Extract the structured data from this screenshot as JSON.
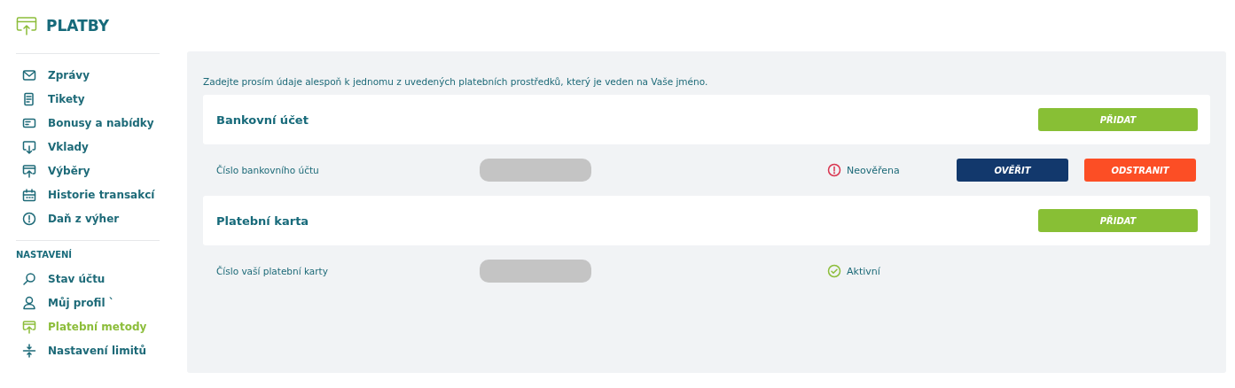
{
  "header": {
    "title": "PLATBY"
  },
  "sidebar": {
    "groups": [
      {
        "items": [
          {
            "label": "Zprávy",
            "selected": false
          },
          {
            "label": "Tikety",
            "selected": false
          },
          {
            "label": "Bonusy a nabídky",
            "selected": false
          },
          {
            "label": "Vklady",
            "selected": false
          },
          {
            "label": "Výběry",
            "selected": false
          },
          {
            "label": "Historie transakcí",
            "selected": false
          },
          {
            "label": "Daň z výher",
            "selected": false
          }
        ]
      },
      {
        "heading": "NASTAVENÍ",
        "items": [
          {
            "label": "Stav účtu",
            "selected": false
          },
          {
            "label": "Můj profil `",
            "selected": false
          },
          {
            "label": "Platební metody",
            "selected": true
          },
          {
            "label": "Nastavení limitů",
            "selected": false
          }
        ]
      }
    ]
  },
  "main": {
    "intro": "Zadejte prosím údaje alespoň k jednomu z uvedených platebních prostředků, který je veden na Vaše jméno.",
    "sections": [
      {
        "title": "Bankovní účet",
        "add_button": "PŘIDAT",
        "row": {
          "label": "Číslo bankovního účtu",
          "masked": true,
          "status": {
            "kind": "unverified",
            "text": "Neověřena"
          },
          "buttons": [
            {
              "kind": "verify",
              "label": "OVĚŘIT"
            },
            {
              "kind": "remove",
              "label": "ODSTRANIT"
            }
          ]
        }
      },
      {
        "title": "Platební karta",
        "add_button": "PŘIDAT",
        "row": {
          "label": "Číslo vaší platební karty",
          "masked": true,
          "status": {
            "kind": "active",
            "text": "Aktivní"
          }
        }
      }
    ]
  }
}
